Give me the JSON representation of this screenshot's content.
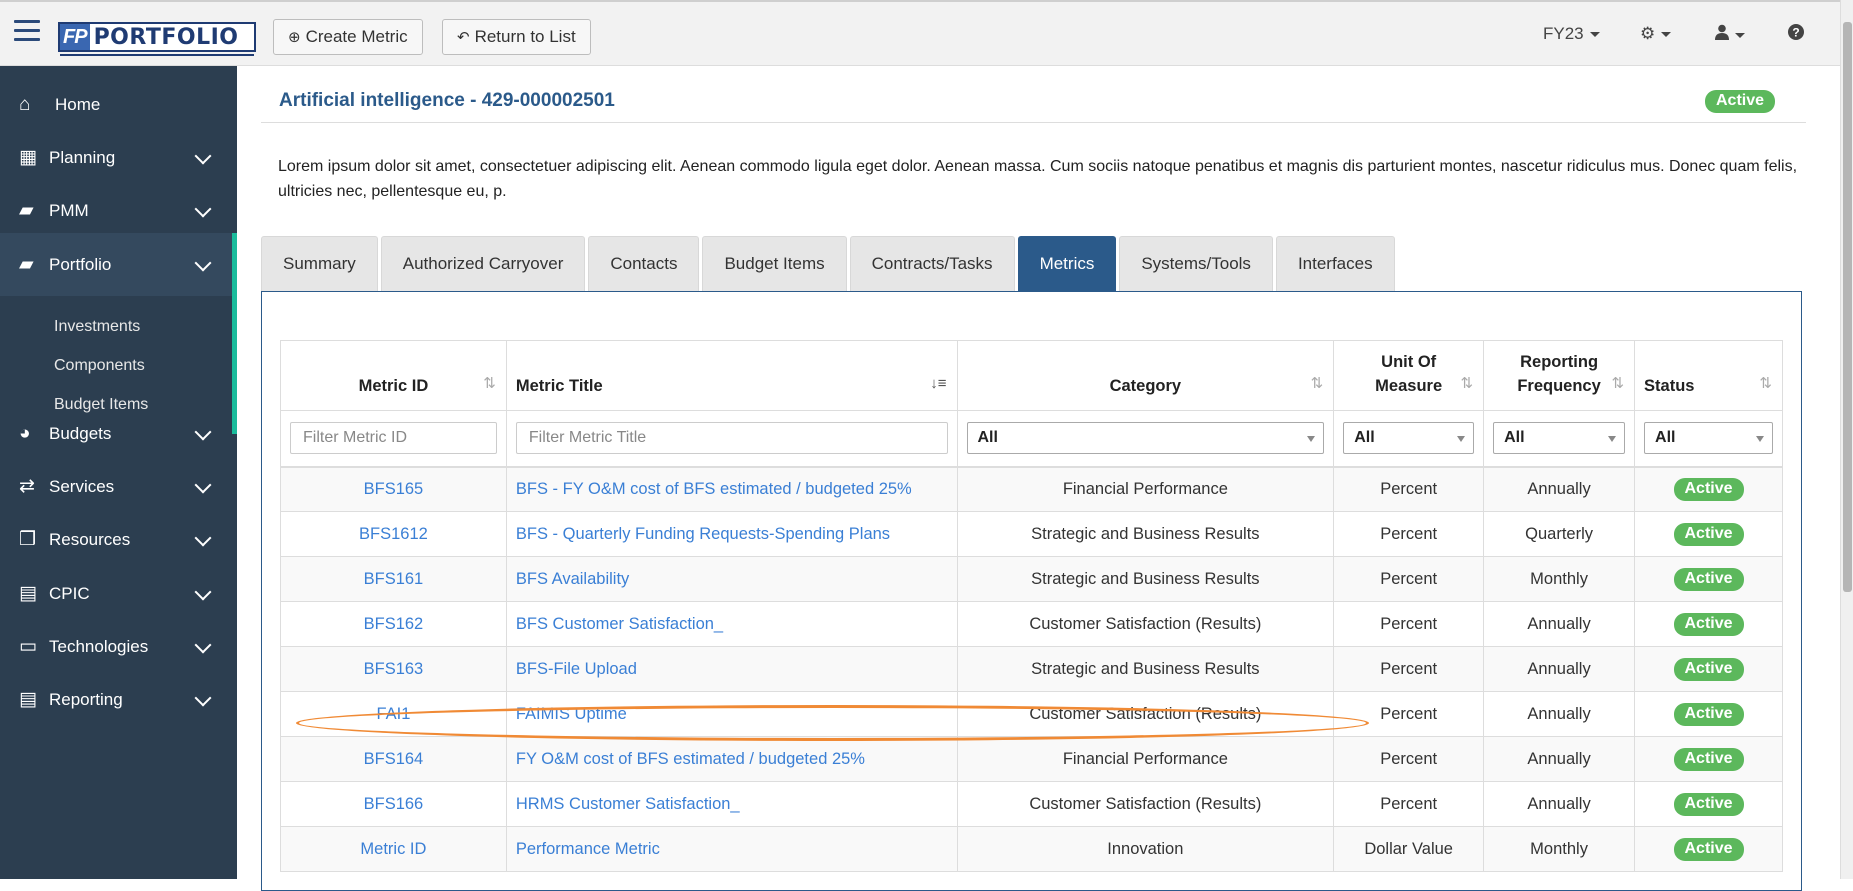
{
  "topbar": {
    "logo_fp": "FP",
    "logo_name": "PORTFOLIO",
    "create_metric_label": "Create Metric",
    "return_label": "Return to List",
    "fiscal_year": "FY23"
  },
  "sidebar": {
    "items": [
      {
        "label": "Home"
      },
      {
        "label": "Planning"
      },
      {
        "label": "PMM"
      },
      {
        "label": "Portfolio"
      },
      {
        "label": "Budgets"
      },
      {
        "label": "Services"
      },
      {
        "label": "Resources"
      },
      {
        "label": "CPIC"
      },
      {
        "label": "Technologies"
      },
      {
        "label": "Reporting"
      }
    ],
    "sub_items": [
      "Investments",
      "Components",
      "Budget Items"
    ]
  },
  "page": {
    "title": "Artificial intelligence - 429-000002501",
    "status": "Active",
    "description": "Lorem ipsum dolor sit amet, consectetuer adipiscing elit. Aenean commodo ligula eget dolor. Aenean massa. Cum sociis natoque penatibus et magnis dis parturient montes, nascetur ridiculus mus. Donec quam felis, ultricies nec, pellentesque eu, p."
  },
  "tabs": [
    "Summary",
    "Authorized Carryover",
    "Contacts",
    "Budget Items",
    "Contracts/Tasks",
    "Metrics",
    "Systems/Tools",
    "Interfaces"
  ],
  "table": {
    "headers": {
      "metric_id": "Metric ID",
      "metric_title": "Metric Title",
      "category": "Category",
      "unit_line1": "Unit Of",
      "unit_line2": "Measure",
      "freq_line1": "Reporting",
      "freq_line2": "Frequency",
      "status": "Status"
    },
    "filters": {
      "metric_id_placeholder": "Filter Metric ID",
      "metric_title_placeholder": "Filter Metric Title",
      "category": "All",
      "unit": "All",
      "frequency": "All",
      "status": "All"
    },
    "rows": [
      {
        "id": "BFS165",
        "title": "BFS - FY O&M cost of BFS estimated / budgeted 25%",
        "category": "Financial Performance",
        "unit": "Percent",
        "frequency": "Annually",
        "status": "Active"
      },
      {
        "id": "BFS1612",
        "title": "BFS - Quarterly Funding Requests-Spending Plans",
        "category": "Strategic and Business Results",
        "unit": "Percent",
        "frequency": "Quarterly",
        "status": "Active"
      },
      {
        "id": "BFS161",
        "title": "BFS Availability",
        "category": "Strategic and Business Results",
        "unit": "Percent",
        "frequency": "Monthly",
        "status": "Active"
      },
      {
        "id": "BFS162",
        "title": "BFS Customer Satisfaction_",
        "category": "Customer Satisfaction (Results)",
        "unit": "Percent",
        "frequency": "Annually",
        "status": "Active"
      },
      {
        "id": "BFS163",
        "title": "BFS-File Upload",
        "category": "Strategic and Business Results",
        "unit": "Percent",
        "frequency": "Annually",
        "status": "Active"
      },
      {
        "id": "FAI1",
        "title": "FAIMIS Uptime",
        "category": "Customer Satisfaction (Results)",
        "unit": "Percent",
        "frequency": "Annually",
        "status": "Active"
      },
      {
        "id": "BFS164",
        "title": "FY O&M cost of BFS estimated / budgeted 25%",
        "category": "Financial Performance",
        "unit": "Percent",
        "frequency": "Annually",
        "status": "Active"
      },
      {
        "id": "BFS166",
        "title": "HRMS Customer Satisfaction_",
        "category": "Customer Satisfaction (Results)",
        "unit": "Percent",
        "frequency": "Annually",
        "status": "Active"
      },
      {
        "id": "Metric ID",
        "title": "Performance Metric",
        "category": "Innovation",
        "unit": "Dollar Value",
        "frequency": "Monthly",
        "status": "Active"
      }
    ]
  }
}
